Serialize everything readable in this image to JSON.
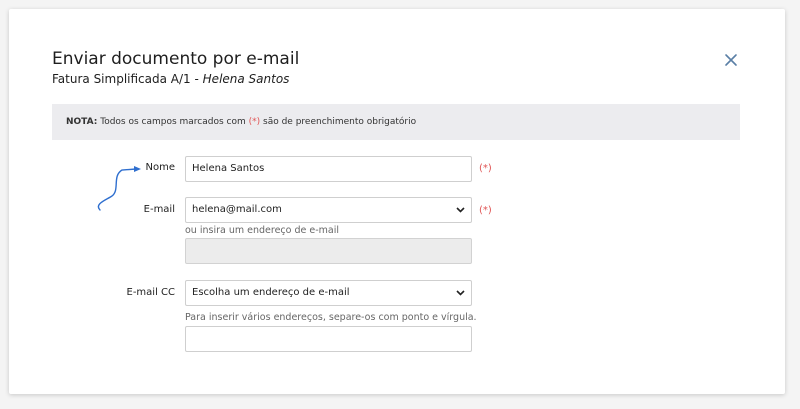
{
  "modal": {
    "title": "Enviar documento por e-mail",
    "document": "Fatura Simplificada A/1 -",
    "client": "Helena Santos"
  },
  "note": {
    "prefix": "NOTA:",
    "text_before": " Todos os campos marcados com ",
    "required_marker": "(*)",
    "text_after": " são de preenchimento obrigatório"
  },
  "form": {
    "name": {
      "label": "Nome",
      "value": "Helena Santos",
      "required_marker": "(*)"
    },
    "email": {
      "label": "E-mail",
      "selected": "helena@mail.com",
      "required_marker": "(*)",
      "alt_hint": "ou insira um endereço de e-mail",
      "alt_value": ""
    },
    "email_cc": {
      "label": "E-mail CC",
      "selected": "Escolha um endereço de e-mail",
      "hint": "Para inserir vários endereços, separe-os com ponto e vírgula.",
      "value": ""
    }
  },
  "icons": {
    "close": "close-icon",
    "dropdown": "chevron-down-icon",
    "annotation": "curved-arrow-icon"
  },
  "colors": {
    "accent": "#2f6fcf",
    "required": "#e05555",
    "close": "#5a7fa6"
  }
}
